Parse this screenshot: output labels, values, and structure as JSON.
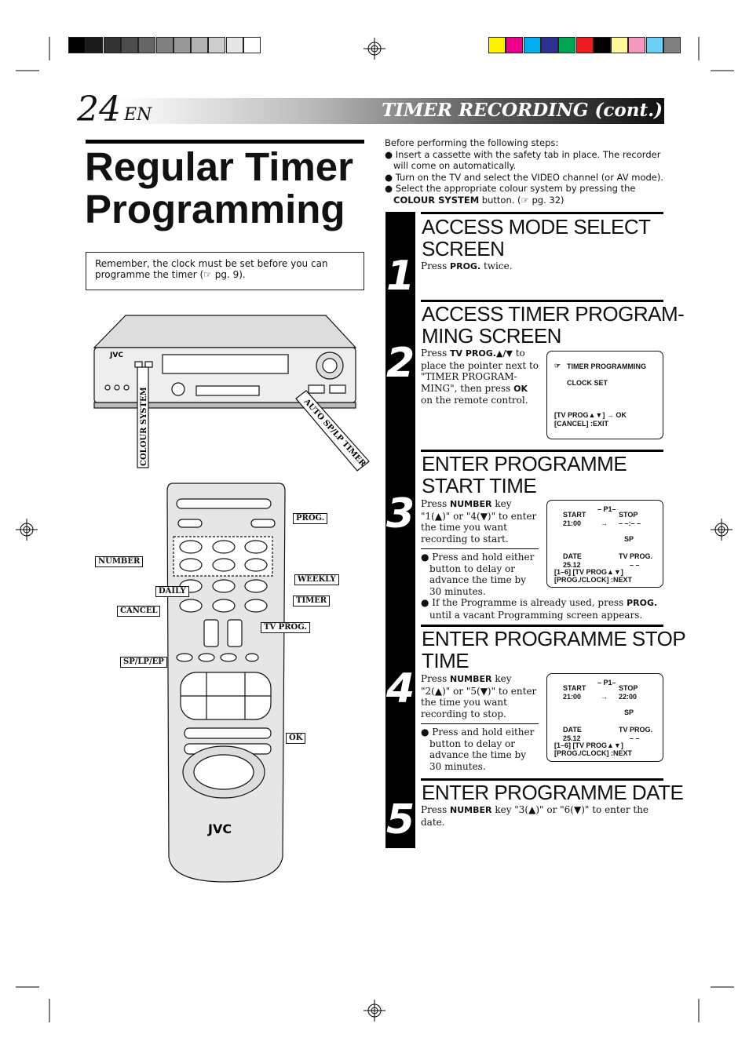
{
  "header": {
    "page_number": "24",
    "lang": "EN",
    "section": "TIMER RECORDING (cont.)"
  },
  "title": {
    "line1": "Regular Timer",
    "line2": "Programming"
  },
  "note": "Remember, the clock must be set before you can programme the timer (☞ pg. 9).",
  "colors": {
    "grayscale": [
      "#000000",
      "#1a1a1a",
      "#333333",
      "#4d4d4d",
      "#666666",
      "#808080",
      "#999999",
      "#b3b3b3",
      "#cccccc",
      "#e6e6e6",
      "#ffffff"
    ],
    "colorbar": [
      "#fff200",
      "#ec008c",
      "#00aeef",
      "#2e3192",
      "#00a651",
      "#ed1c24",
      "#000000",
      "#fff799",
      "#f49ac1",
      "#6dcff6",
      "#808080"
    ]
  },
  "vcr": {
    "brand": "JVC",
    "colour_system": "COLOUR SYSTEM",
    "auto_timer": "AUTO SP/LP TIMER"
  },
  "remote": {
    "brand": "JVC",
    "labels": {
      "prog": "PROG.",
      "number": "NUMBER",
      "weekly": "WEEKLY",
      "daily": "DAILY",
      "timer": "TIMER",
      "cancel": "CANCEL",
      "tvprog": "TV PROG.",
      "splpep": "SP/LP/EP",
      "ok": "OK"
    }
  },
  "intro": {
    "lead": "Before performing the following steps:",
    "bullets": [
      "Insert a cassette with the safety tab in place. The recorder will come on automatically.",
      "Turn on the TV and select the VIDEO channel (or AV mode)."
    ],
    "b3_pre": "Select the appropriate colour system by pressing the ",
    "b3_bold": "COLOUR SYSTEM",
    "b3_post": " button. (☞ pg. 32)"
  },
  "steps": [
    {
      "num": "1",
      "heading1": "ACCESS MODE SELECT",
      "heading2": "SCREEN",
      "t_pre": "Press ",
      "t_bold": "PROG.",
      "t_post": " twice."
    },
    {
      "num": "2",
      "heading1": "ACCESS TIMER PROGRAM-",
      "heading2": "MING SCREEN",
      "t_pre": "Press ",
      "t_bold": "TV PROG.▲/▼",
      "t_mid": " to place the pointer next to \"TIMER PROGRAM-MING\", then press ",
      "t_bold2": "OK",
      "t_post": " on the remote control.",
      "screen": {
        "line1": "TIMER PROGRAMMING",
        "line2": "CLOCK SET",
        "line3": "[TV PROG▲▼] → OK",
        "line4": "[CANCEL] :EXIT"
      }
    },
    {
      "num": "3",
      "heading1": "ENTER PROGRAMME",
      "heading2": "START TIME",
      "t_pre": "Press ",
      "t_bold": "NUMBER",
      "t_post": " key \"1(▲)\" or \"4(▼)\" to enter the time you want recording to start.",
      "bullet1": "Press and hold either button to delay or advance the time by 30 minutes.",
      "b2_pre": "If the Programme is already used, press ",
      "b2_bold": "PROG.",
      "b2_post": " until a vacant Programming screen appears.",
      "screen": {
        "prog": "– P1–",
        "start": "START",
        "stop": "STOP",
        "start_time": "21:00",
        "arrow": "→",
        "stop_time": "– –:– –",
        "speed": "SP",
        "date": "DATE",
        "tvprog": "TV PROG.",
        "date_val": "25.12",
        "tvprog_val": "– –",
        "l1": "[1–6] [TV PROG▲▼]",
        "l2": "[PROG./CLOCK] :NEXT"
      }
    },
    {
      "num": "4",
      "heading1": "ENTER PROGRAMME STOP",
      "heading2": "TIME",
      "t_pre": "Press ",
      "t_bold": "NUMBER",
      "t_post": " key \"2(▲)\" or \"5(▼)\" to enter the time you want recording to stop.",
      "bullet1": "Press and hold either button to delay or advance the time by 30 minutes.",
      "screen": {
        "prog": "– P1–",
        "start": "START",
        "stop": "STOP",
        "start_time": "21:00",
        "arrow": "→",
        "stop_time": "22:00",
        "speed": "SP",
        "date": "DATE",
        "tvprog": "TV PROG.",
        "date_val": "25.12",
        "tvprog_val": "– –",
        "l1": "[1–6] [TV PROG▲▼]",
        "l2": "[PROG./CLOCK] :NEXT"
      }
    },
    {
      "num": "5",
      "heading1": "ENTER PROGRAMME DATE",
      "t_pre": "Press ",
      "t_bold": "NUMBER",
      "t_post": " key \"3(▲)\" or \"6(▼)\" to enter the date."
    }
  ]
}
